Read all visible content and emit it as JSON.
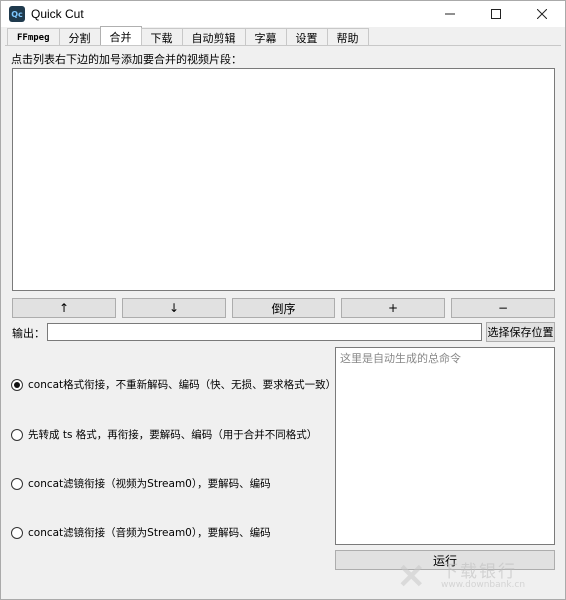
{
  "window": {
    "title": "Quick Cut",
    "icon_text": "Qc"
  },
  "tabs": [
    {
      "label": "FFmpeg"
    },
    {
      "label": "分割"
    },
    {
      "label": "合并"
    },
    {
      "label": "下载"
    },
    {
      "label": "自动剪辑"
    },
    {
      "label": "字幕"
    },
    {
      "label": "设置"
    },
    {
      "label": "帮助"
    }
  ],
  "active_tab": "合并",
  "merge": {
    "hint": "点击列表右下边的加号添加要合并的视频片段：",
    "buttons": {
      "up": "↑",
      "down": "↓",
      "reverse": "倒序",
      "add": "+",
      "remove": "−"
    },
    "output_label": "输出：",
    "output_value": "",
    "choose_location": "选择保存位置",
    "command_placeholder": "这里是自动生成的总命令",
    "options": [
      {
        "label": "concat格式衔接，不重新解码、编码（快、无损、要求格式一致）",
        "checked": true
      },
      {
        "label": "先转成 ts 格式，再衔接，要解码、编码（用于合并不同格式）",
        "checked": false
      },
      {
        "label": "concat滤镜衔接（视频为Stream0），要解码、编码",
        "checked": false
      },
      {
        "label": "concat滤镜衔接（音频为Stream0），要解码、编码",
        "checked": false
      }
    ],
    "run": "运行"
  },
  "watermark": {
    "cn": "下载银行",
    "en": "www.downbank.cn"
  }
}
